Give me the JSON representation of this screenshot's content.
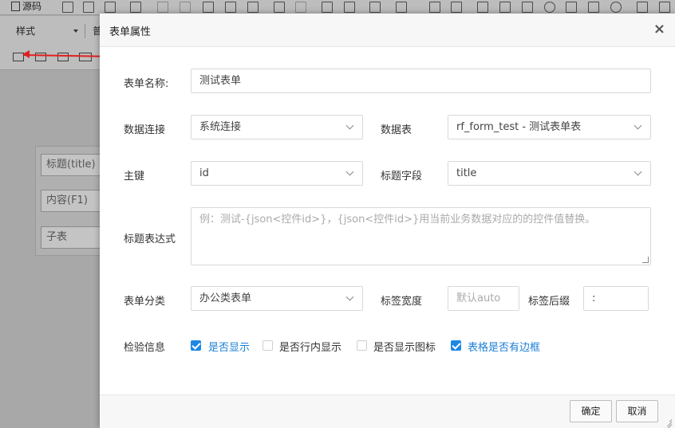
{
  "editor": {
    "source_label": "源码",
    "style_combo": "样式",
    "para_combo": "普",
    "canvas_fields": [
      "标题(title)",
      "内容(F1)",
      "子表"
    ]
  },
  "modal": {
    "title": "表单属性",
    "close": "×",
    "form_name_label": "表单名称:",
    "form_name_value": "测试表单",
    "db_conn_label": "数据连接",
    "db_conn_value": "系统连接",
    "table_label": "数据表",
    "table_value": "rf_form_test - 测试表单表",
    "pk_label": "主键",
    "pk_value": "id",
    "title_field_label": "标题字段",
    "title_field_value": "title",
    "title_expr_label": "标题表达式",
    "title_expr_placeholder": "例：测试-{json<控件id>}，{json<控件id>}用当前业务数据对应的的控件值替换。",
    "category_label": "表单分类",
    "category_value": "办公类表单",
    "label_width_label": "标签宽度",
    "label_width_placeholder": "默认auto",
    "label_suffix_label": "标签后缀",
    "label_suffix_value": ":",
    "validation_label": "检验信息",
    "checks": [
      {
        "label": "是否显示",
        "checked": true
      },
      {
        "label": "是否行内显示",
        "checked": false
      },
      {
        "label": "是否显示图标",
        "checked": false
      },
      {
        "label": "表格是否有边框",
        "checked": true
      }
    ],
    "ok_label": "确定",
    "cancel_label": "取消"
  },
  "colors": {
    "accent": "#1e88e5",
    "arrow": "#e02020"
  },
  "icons": [
    "close-icon",
    "chevron-down-icon",
    "resize-grip-icon"
  ]
}
